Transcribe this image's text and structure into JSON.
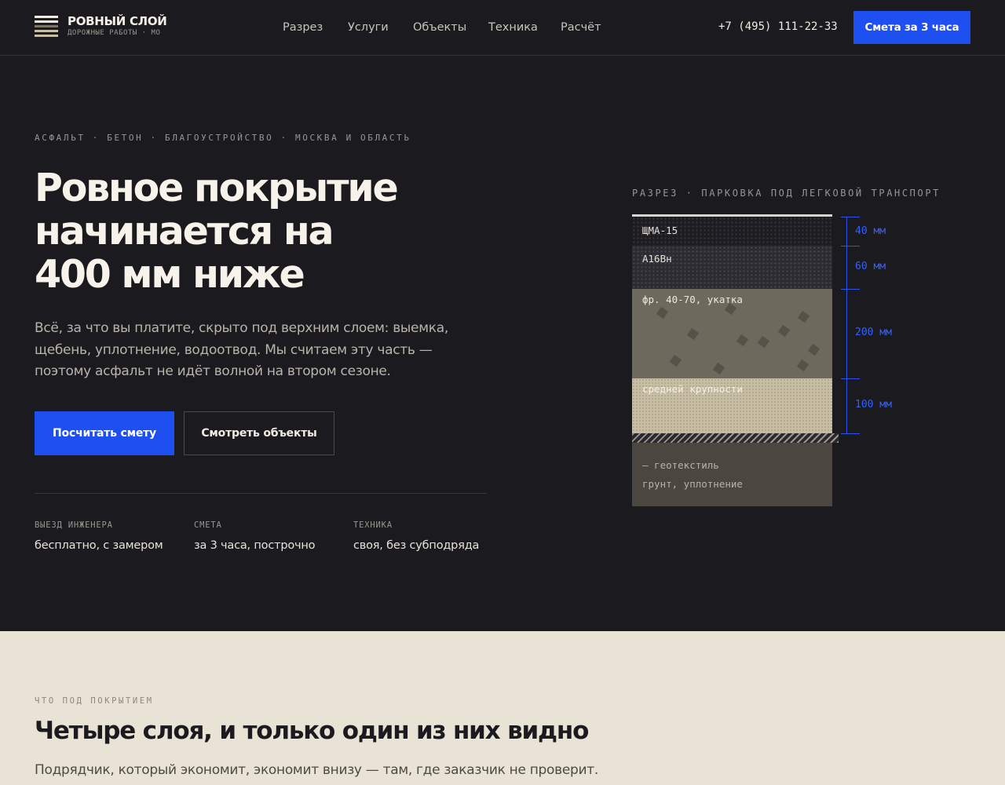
{
  "header": {
    "brand": {
      "name": "РОВНЫЙ СЛОЙ",
      "tagline": "ДОРОЖНЫЕ РАБОТЫ · МО",
      "icon": "layered-road-logo-icon"
    },
    "nav": [
      {
        "label": "Разрез"
      },
      {
        "label": "Услуги"
      },
      {
        "label": "Объекты"
      },
      {
        "label": "Техника"
      },
      {
        "label": "Расчёт"
      }
    ],
    "phone": "+7 (495) 111-22-33",
    "cta": "Смета за 3 часа"
  },
  "hero": {
    "eyebrow": "АСФАЛЬТ · БЕТОН · БЛАГОУСТРОЙСТВО · МОСКВА И ОБЛАСТЬ",
    "title_lines": [
      "Ровное покрытие",
      "начинается на",
      "400 мм ниже"
    ],
    "lead": "Всё, за что вы платите, скрыто под верхним слоем: выемка, щебень, уплотнение, водоотвод. Мы считаем эту часть — поэтому асфальт не идёт волной на втором сезоне.",
    "primary_button": "Посчитать смету",
    "secondary_button": "Смотреть объекты",
    "facts": [
      {
        "label": "ВЫЕЗД ИНЖЕНЕРА",
        "value": "бесплатно, с замером"
      },
      {
        "label": "СМЕТА",
        "value": "за 3 часа, построчно"
      },
      {
        "label": "ТЕХНИКА",
        "value": "своя, без субподряда"
      }
    ]
  },
  "section_diagram": {
    "caption": "РАЗРЕЗ · ПАРКОВКА ПОД ЛЕГКОВОЙ ТРАНСПОРТ",
    "layers": [
      {
        "label": "ЩМА-15",
        "thickness": "40 мм",
        "color": "#1d1c21"
      },
      {
        "label": "А16Вн",
        "thickness": "60 мм",
        "color": "#2c2b31"
      },
      {
        "label": "фр. 40-70, укатка",
        "thickness": "200 мм",
        "color": "#6e695d"
      },
      {
        "label": "средней крупности",
        "thickness": "100 мм",
        "color": "#c8bea5"
      }
    ],
    "geotextile_label": "— геотекстиль",
    "soil_label": "грунт, уплотнение",
    "dimension_color": "#2f55e8"
  },
  "next_section": {
    "eyebrow": "ЧТО ПОД ПОКРЫТИЕМ",
    "title": "Четыре слоя, и только один из них видно",
    "text": "Подрядчик, который экономит, экономит внизу — там, где заказчик не проверит."
  },
  "colors": {
    "background": "#1b1a1e",
    "accent": "#1e4ff0",
    "beige": "#e9e3d6"
  }
}
